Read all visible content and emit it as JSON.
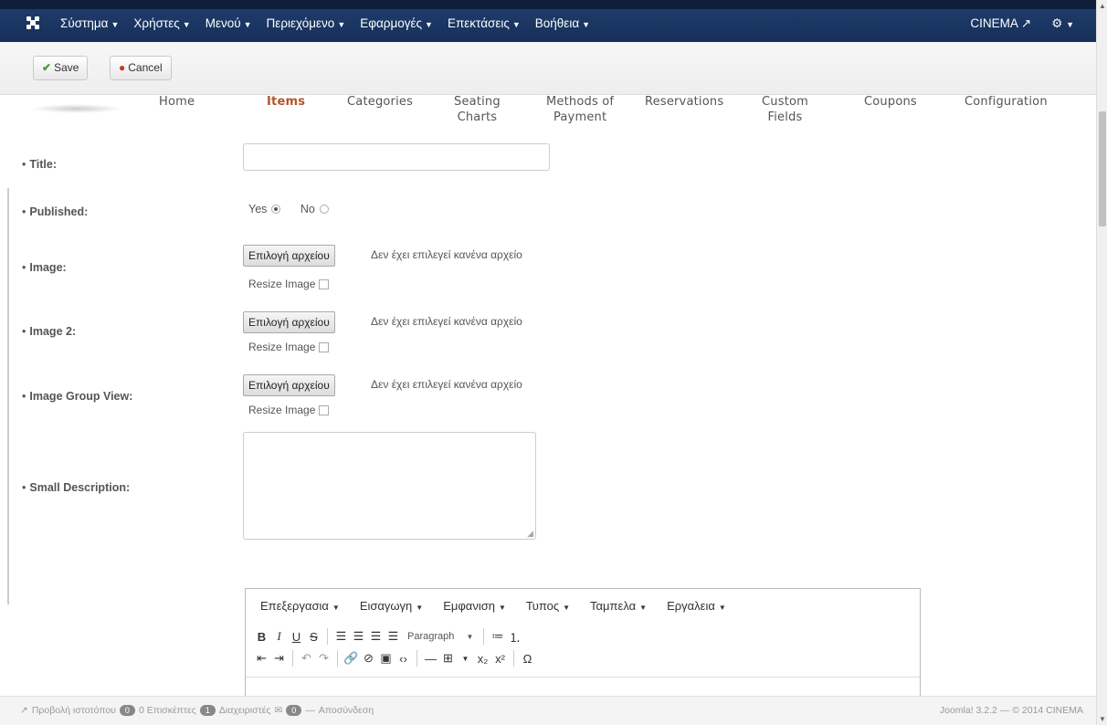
{
  "topbar": {
    "menu": [
      "Σύστημα",
      "Χρήστες",
      "Μενού",
      "Περιεχόμενο",
      "Εφαρμογές",
      "Επεκτάσεις",
      "Βοήθεια"
    ],
    "site": "CINEMA",
    "brand_color": "#1f3b69"
  },
  "toolbar": {
    "save": "Save",
    "cancel": "Cancel"
  },
  "subnav": {
    "tabs": [
      {
        "line1": "Home",
        "line2": ""
      },
      {
        "line1": "Items",
        "line2": ""
      },
      {
        "line1": "Categories",
        "line2": ""
      },
      {
        "line1": "Seating",
        "line2": "Charts"
      },
      {
        "line1": "Methods of",
        "line2": "Payment"
      },
      {
        "line1": "Reservations",
        "line2": ""
      },
      {
        "line1": "Custom",
        "line2": "Fields"
      },
      {
        "line1": "Coupons",
        "line2": ""
      },
      {
        "line1": "Configuration",
        "line2": ""
      }
    ],
    "active_index": 1
  },
  "form": {
    "title_label": "Title:",
    "published_label": "Published:",
    "yes": "Yes",
    "no": "No",
    "image_label": "Image:",
    "image2_label": "Image 2:",
    "image_group_label": "Image Group View:",
    "small_desc_label": "Small Description:",
    "file_button": "Επιλογή αρχείου",
    "no_file": "Δεν έχει επιλεγεί κανένα αρχείο",
    "resize": "Resize Image"
  },
  "editor": {
    "menus": [
      "Επεξεργασια",
      "Εισαγωγη",
      "Εμφανιση",
      "Τυπος",
      "Ταμπελα",
      "Εργαλεια"
    ],
    "format": "Paragraph"
  },
  "status": {
    "view_site": "Προβολή ιστοτόπου",
    "visitors": "0 Επισκέπτες",
    "admins": "Διαχειριστές",
    "logout": "Αποσύνδεση",
    "version": "Joomla! 3.2.2 — © 2014 CINEMA"
  }
}
